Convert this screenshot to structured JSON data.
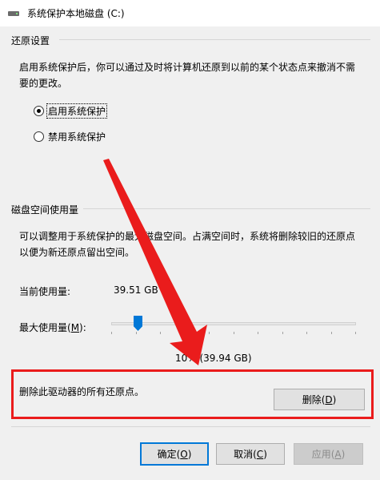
{
  "window": {
    "title": "系统保护本地磁盘 (C:)",
    "icon": "drive-icon"
  },
  "restore": {
    "group_label": "还原设置",
    "description": "启用系统保护后，你可以通过及时将计算机还原到以前的某个状态点来撤消不需要的更改。",
    "options": [
      {
        "label": "启用系统保护",
        "checked": true
      },
      {
        "label": "禁用系统保护",
        "checked": false
      }
    ]
  },
  "disk": {
    "group_label": "磁盘空间使用量",
    "description": "可以调整用于系统保护的最大磁盘空间。占满空间时，系统将删除较旧的还原点以便为新还原点留出空间。",
    "current_label": "当前使用量:",
    "current_value": "39.51 GB",
    "max_label_prefix": "最大使用量(",
    "max_label_key": "M",
    "max_label_suffix": "):",
    "slider_fraction": 0.1,
    "percent_text": "10% (39.94 GB)"
  },
  "delete": {
    "text": "删除此驱动器的所有还原点。",
    "button_prefix": "删除(",
    "button_key": "D",
    "button_suffix": ")"
  },
  "footer": {
    "ok_prefix": "确定(",
    "ok_key": "O",
    "ok_suffix": ")",
    "cancel_prefix": "取消(",
    "cancel_key": "C",
    "cancel_suffix": ")",
    "apply_prefix": "应用(",
    "apply_key": "A",
    "apply_suffix": ")"
  },
  "colors": {
    "accent": "#0078d7",
    "annotation_red": "#ea1c1c"
  }
}
